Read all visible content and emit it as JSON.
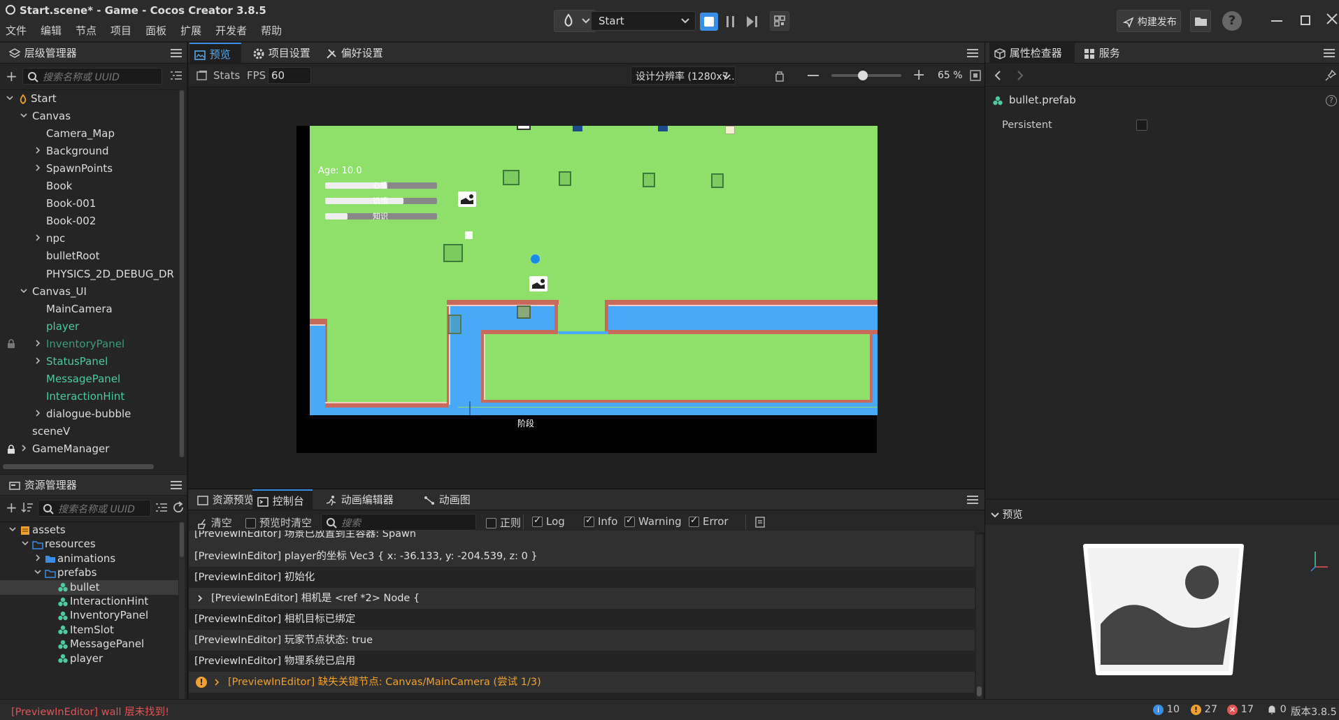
{
  "window": {
    "title": "Start.scene* - Game - Cocos Creator 3.8.5",
    "menu": [
      "文件",
      "编辑",
      "节点",
      "项目",
      "面板",
      "扩展",
      "开发者",
      "帮助"
    ],
    "scene_select": "Start",
    "build_button": "构建发布"
  },
  "hierarchy": {
    "tab": "层级管理器",
    "search_placeholder": "搜索名称或 UUID",
    "nodes": [
      {
        "label": "Start",
        "depth": 0,
        "arrow": "open",
        "icon": "scene"
      },
      {
        "label": "Canvas",
        "depth": 1,
        "arrow": "open"
      },
      {
        "label": "Camera_Map",
        "depth": 2,
        "arrow": ""
      },
      {
        "label": "Background",
        "depth": 2,
        "arrow": "closed"
      },
      {
        "label": "SpawnPoints",
        "depth": 2,
        "arrow": "closed"
      },
      {
        "label": "Book",
        "depth": 2,
        "arrow": ""
      },
      {
        "label": "Book-001",
        "depth": 2,
        "arrow": ""
      },
      {
        "label": "Book-002",
        "depth": 2,
        "arrow": ""
      },
      {
        "label": "npc",
        "depth": 2,
        "arrow": "closed"
      },
      {
        "label": "bulletRoot",
        "depth": 2,
        "arrow": ""
      },
      {
        "label": "PHYSICS_2D_DEBUG_DR",
        "depth": 2,
        "arrow": ""
      },
      {
        "label": "Canvas_UI",
        "depth": 1,
        "arrow": "open"
      },
      {
        "label": "MainCamera",
        "depth": 2,
        "arrow": ""
      },
      {
        "label": "player",
        "depth": 2,
        "arrow": "",
        "prefab": true
      },
      {
        "label": "InventoryPanel",
        "depth": 2,
        "arrow": "closed",
        "prefab": true,
        "dim": true,
        "lock": true
      },
      {
        "label": "StatusPanel",
        "depth": 2,
        "arrow": "closed",
        "prefab": true
      },
      {
        "label": "MessagePanel",
        "depth": 2,
        "arrow": "",
        "prefab": true
      },
      {
        "label": "InteractionHint",
        "depth": 2,
        "arrow": "",
        "prefab": true
      },
      {
        "label": "dialogue-bubble",
        "depth": 2,
        "arrow": "closed"
      },
      {
        "label": "sceneV",
        "depth": 1,
        "arrow": ""
      },
      {
        "label": "GameManager",
        "depth": 1,
        "arrow": "closed",
        "lock": true
      }
    ]
  },
  "assets": {
    "tab": "资源管理器",
    "search_placeholder": "搜索名称或 UUID",
    "nodes": [
      {
        "label": "assets",
        "depth": 0,
        "arrow": "open",
        "icon": "db"
      },
      {
        "label": "resources",
        "depth": 1,
        "arrow": "open",
        "icon": "folder-open"
      },
      {
        "label": "animations",
        "depth": 2,
        "arrow": "closed",
        "icon": "folder"
      },
      {
        "label": "prefabs",
        "depth": 2,
        "arrow": "open",
        "icon": "folder-open"
      },
      {
        "label": "bullet",
        "depth": 3,
        "arrow": "",
        "icon": "prefab",
        "selected": true
      },
      {
        "label": "InteractionHint",
        "depth": 3,
        "arrow": "",
        "icon": "prefab"
      },
      {
        "label": "InventoryPanel",
        "depth": 3,
        "arrow": "",
        "icon": "prefab"
      },
      {
        "label": "ItemSlot",
        "depth": 3,
        "arrow": "",
        "icon": "prefab"
      },
      {
        "label": "MessagePanel",
        "depth": 3,
        "arrow": "",
        "icon": "prefab"
      },
      {
        "label": "player",
        "depth": 3,
        "arrow": "",
        "icon": "prefab"
      }
    ]
  },
  "preview": {
    "tabs": [
      "预览",
      "项目设置",
      "偏好设置"
    ],
    "stats": "Stats",
    "fps_label": "FPS",
    "fps_value": "60",
    "resolution": "设计分辨率 (1280x7...",
    "zoom": "65 %",
    "zoom_fraction": 0.45,
    "game": {
      "age": "Age: 10.0",
      "bars": [
        {
          "label": "心情",
          "fill": 0.55
        },
        {
          "label": "饥饿",
          "fill": 0.7
        },
        {
          "label": "知识",
          "fill": 0.2
        }
      ],
      "stage": "阶段"
    }
  },
  "bottom": {
    "tabs": [
      "资源预览",
      "控制台",
      "动画编辑器",
      "动画图"
    ],
    "clear": "清空",
    "clear_on_preview": "预览时清空",
    "search_placeholder": "搜索",
    "regex": "正则",
    "filters": [
      "Log",
      "Info",
      "Warning",
      "Error"
    ],
    "logs": [
      {
        "text": "[PreviewInEditor] 场景已放置到主容器: Spawn",
        "type": "cut"
      },
      {
        "text": "[PreviewInEditor] player的坐标 Vec3 { x: -36.133, y: -204.539, z: 0 }",
        "type": "log"
      },
      {
        "text": "[PreviewInEditor] 初始化",
        "type": "log"
      },
      {
        "text": "[PreviewInEditor] 相机是 <ref *2> Node {",
        "type": "expand"
      },
      {
        "text": "[PreviewInEditor] 相机目标已绑定",
        "type": "log"
      },
      {
        "text": "[PreviewInEditor] 玩家节点状态: true",
        "type": "log"
      },
      {
        "text": "[PreviewInEditor] 物理系统已启用",
        "type": "log"
      },
      {
        "text": "[PreviewInEditor] 缺失关键节点: Canvas/MainCamera (尝试 1/3)",
        "type": "warn"
      }
    ]
  },
  "inspector": {
    "tabs": [
      "属性检查器",
      "服务"
    ],
    "asset_name": "bullet.prefab",
    "prop_label": "Persistent",
    "preview_title": "预览"
  },
  "status": {
    "message": "[PreviewInEditor] wall 层未找到!",
    "info_count": "10",
    "warn_count": "27",
    "error_count": "17",
    "notify_count": "0",
    "version": "版本3.8.5"
  },
  "colors": {
    "accent": "#3a8ee6",
    "game_grass": "#8ee06a",
    "game_water": "#4aa8f8",
    "game_wall": "#c86a5a",
    "prefab_green": "#4ec9a0",
    "warn": "#f0a030",
    "error_text": "#e05555"
  }
}
